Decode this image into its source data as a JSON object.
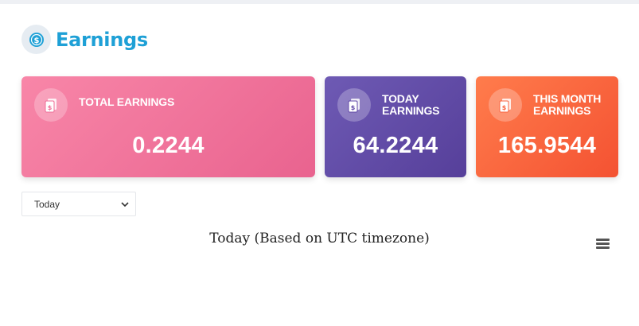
{
  "header": {
    "title": "Earnings",
    "icon": "dollar-coin-icon"
  },
  "cards": [
    {
      "label": "TOTAL EARNINGS",
      "value": "0.2244",
      "icon": "money-stack-icon",
      "color": "#ef6f98"
    },
    {
      "label": "TODAY\nEARNINGS",
      "value": "64.2244",
      "icon": "money-stack-icon",
      "color": "#6249a8"
    },
    {
      "label": "THIS MONTH\nEARNINGS",
      "value": "165.9544",
      "icon": "money-stack-icon",
      "color": "#fa6540"
    }
  ],
  "filter": {
    "selected": "Today"
  },
  "chart": {
    "title": "Today (Based on UTC timezone)"
  },
  "colors": {
    "accent": "#1ea0d6"
  }
}
